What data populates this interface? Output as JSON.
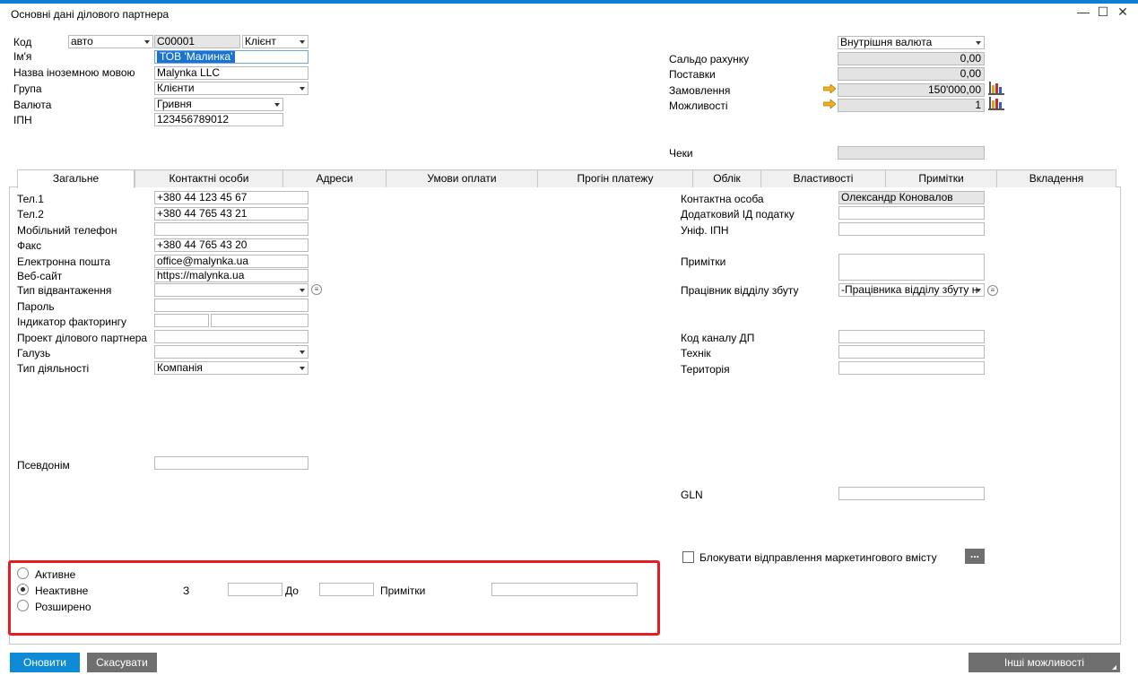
{
  "window": {
    "title": "Основні дані ділового партнера",
    "minimize": "—",
    "maximize": "☐",
    "close": "✕"
  },
  "header_left": {
    "code_label": "Код",
    "code_series": "авто",
    "code_value": "C00001",
    "code_type": "Клієнт",
    "name_label": "Ім'я",
    "name_value": "ТОВ 'Малинка'",
    "foreign_name_label": "Назва іноземною мовою",
    "foreign_name_value": "Malynka LLC",
    "group_label": "Група",
    "group_value": "Клієнти",
    "currency_label": "Валюта",
    "currency_value": "Гривня",
    "tax_id_label": "ІПН",
    "tax_id_value": "123456789012"
  },
  "header_right": {
    "currency_type": "Внутрішня валюта",
    "balance_label": "Сальдо рахунку",
    "balance_value": "0,00",
    "deliveries_label": "Поставки",
    "deliveries_value": "0,00",
    "orders_label": "Замовлення",
    "orders_value": "150'000,00",
    "opportunities_label": "Можливості",
    "opportunities_value": "1",
    "checks_label": "Чеки",
    "checks_value": ""
  },
  "tabs": [
    {
      "label": "Загальне"
    },
    {
      "label": "Контактні особи"
    },
    {
      "label": "Адреси"
    },
    {
      "label": "Умови оплати"
    },
    {
      "label": "Прогін платежу"
    },
    {
      "label": "Облік"
    },
    {
      "label": "Властивості"
    },
    {
      "label": "Примітки"
    },
    {
      "label": "Вкладення"
    }
  ],
  "general_left": {
    "tel1_label": "Тел.1",
    "tel1_value": "+380 44 123 45 67",
    "tel2_label": "Тел.2",
    "tel2_value": "+380 44 765 43 21",
    "mobile_label": "Мобільний телефон",
    "mobile_value": "",
    "fax_label": "Факс",
    "fax_value": "+380 44 765 43 20",
    "email_label": "Електронна пошта",
    "email_value": "office@malynka.ua",
    "website_label": "Веб-сайт",
    "website_value": "https://malynka.ua",
    "shipping_label": "Тип відвантаження",
    "shipping_value": "",
    "password_label": "Пароль",
    "password_value": "",
    "factoring_label": "Індикатор факторингу",
    "factoring_value_1": "",
    "factoring_value_2": "",
    "project_label": "Проект ділового партнера",
    "project_value": "",
    "industry_label": "Галузь",
    "industry_value": "",
    "business_type_label": "Тип діяльності",
    "business_type_value": "Компанія",
    "alias_label": "Псевдонім",
    "alias_value": ""
  },
  "general_right": {
    "contact_label": "Контактна особа",
    "contact_value": "Олександр Коновалов",
    "add_tax_label": "Додатковий ІД податку",
    "add_tax_value": "",
    "unified_tax_label": "Уніф. ІПН",
    "unified_tax_value": "",
    "remarks_label": "Примітки",
    "remarks_value": "",
    "sales_emp_label": "Працівник відділу збуту",
    "sales_emp_value": "-Працівника відділу збуту н",
    "channel_label": "Код каналу ДП",
    "channel_value": "",
    "technician_label": "Технік",
    "technician_value": "",
    "territory_label": "Територія",
    "territory_value": "",
    "gln_label": "GLN",
    "gln_value": "",
    "block_marketing_label": "Блокувати відправлення маркетингового вмісту",
    "more_btn": "..."
  },
  "status": {
    "active_label": "Активне",
    "inactive_label": "Неактивне",
    "advanced_label": "Розширено",
    "from_label": "З",
    "from_value": "",
    "to_label": "До",
    "to_value": "",
    "remarks_label": "Примітки",
    "remarks_value": "",
    "selected": "inactive"
  },
  "footer": {
    "update_btn": "Оновити",
    "cancel_btn": "Скасувати",
    "other_btn": "Інші можливості"
  },
  "colors": {
    "accent": "#0f7fd4",
    "highlight": "#e51c23",
    "button_gray": "#6f6f6f",
    "arrow": "#f2b01e"
  }
}
